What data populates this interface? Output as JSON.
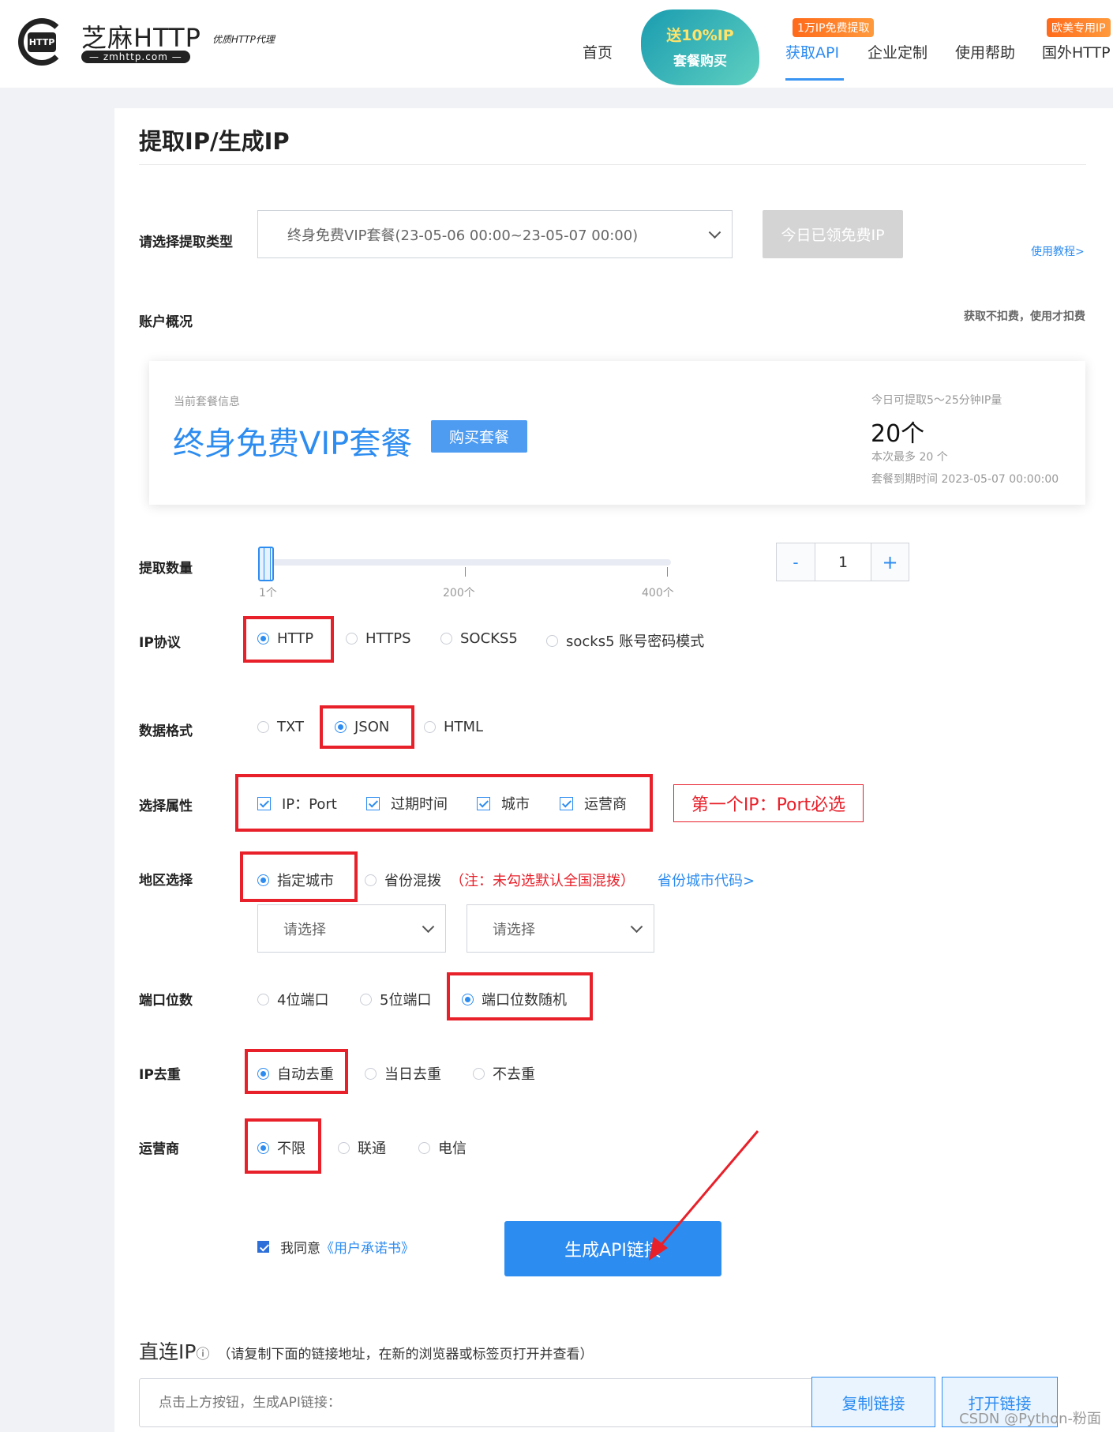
{
  "header": {
    "logo": {
      "name": "芝麻HTTP",
      "slogan": "优质HTTP代理",
      "domain": "— zmhttp.com —",
      "icon_text": "HTTP"
    },
    "nav": [
      {
        "label": "首页"
      },
      {
        "label": "获取API",
        "active": true,
        "badge": "1万IP免费提取"
      },
      {
        "label": "企业定制"
      },
      {
        "label": "使用帮助"
      },
      {
        "label": "国外HTTP",
        "badge": "欧美专用IP"
      }
    ],
    "promo": {
      "line1": "送10%IP",
      "line2": "套餐购买"
    },
    "accent": "#2d8cf0"
  },
  "page": {
    "title": "提取IP/生成IP"
  },
  "type": {
    "label": "请选择提取类型",
    "value": "终身免费VIP套餐(23-05-06 00:00~23-05-07 00:00)",
    "claimed_button": "今日已领免费IP",
    "tutorial_link": "使用教程>"
  },
  "account": {
    "label": "账户概况",
    "note": "获取不扣费，使用才扣费",
    "card": {
      "caption": "当前套餐信息",
      "plan": "终身免费VIP套餐",
      "buy_button": "购买套餐",
      "quota_caption": "今日可提取5～25分钟IP量",
      "quota": "20个",
      "max": "本次最多 20 个",
      "expire": "套餐到期时间 2023-05-07 00:00:00"
    }
  },
  "quantity": {
    "label": "提取数量",
    "ticks": [
      "1个",
      "200个",
      "400个"
    ],
    "value": "1",
    "minus": "-",
    "plus": "+",
    "slider_value": 1,
    "slider_max": 400
  },
  "protocol": {
    "label": "IP协议",
    "options": [
      "HTTP",
      "HTTPS",
      "SOCKS5",
      "socks5 账号密码模式"
    ],
    "selected": "HTTP"
  },
  "format": {
    "label": "数据格式",
    "options": [
      "TXT",
      "JSON",
      "HTML"
    ],
    "selected": "JSON"
  },
  "attrs": {
    "label": "选择属性",
    "options": [
      "IP：Port",
      "过期时间",
      "城市",
      "运营商"
    ],
    "annotation": "第一个IP：Port必选"
  },
  "region": {
    "label": "地区选择",
    "options": [
      "指定城市",
      "省份混拨"
    ],
    "selected": "指定城市",
    "note": "（注：未勾选默认全国混拨）",
    "code_link": "省份城市代码>",
    "province_placeholder": "请选择",
    "city_placeholder": "请选择"
  },
  "port": {
    "label": "端口位数",
    "options": [
      "4位端口",
      "5位端口",
      "端口位数随机"
    ],
    "selected": "端口位数随机"
  },
  "dedup": {
    "label": "IP去重",
    "options": [
      "自动去重",
      "当日去重",
      "不去重"
    ],
    "selected": "自动去重"
  },
  "isp": {
    "label": "运营商",
    "options": [
      "不限",
      "联通",
      "电信"
    ],
    "selected": "不限"
  },
  "agree": {
    "text": "我同意",
    "link": "《用户承诺书》",
    "checked": true
  },
  "generate_button": "生成API链接",
  "direct": {
    "title": "直连IP",
    "info_icon": "ⓘ",
    "note": "（请复制下面的链接地址，在新的浏览器或标签页打开并查看）",
    "placeholder": "点击上方按钮，生成API链接：",
    "copy": "复制链接",
    "open": "打开链接"
  },
  "watermark": "CSDN @Python-粉面"
}
